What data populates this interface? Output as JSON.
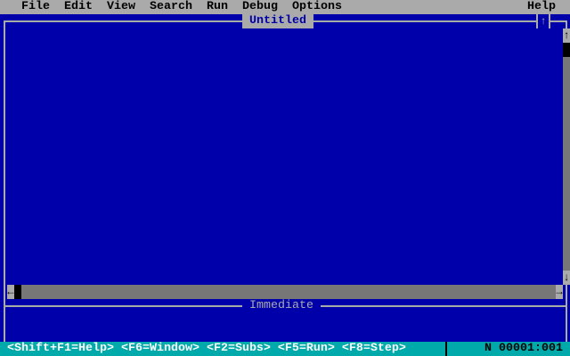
{
  "menu": [
    "File",
    "Edit",
    "View",
    "Search",
    "Run",
    "Debug",
    "Options"
  ],
  "help": "Help",
  "editor": {
    "title": "Untitled"
  },
  "immediate": {
    "title": "Immediate"
  },
  "status": {
    "hints": "<Shift+F1=Help> <F6=Window> <F2=Subs> <F5=Run> <F8=Step>",
    "position": "N 00001:001"
  },
  "icons": {
    "maximize": "↑",
    "up": "↑",
    "down": "↓",
    "left": "←",
    "right": "→"
  }
}
